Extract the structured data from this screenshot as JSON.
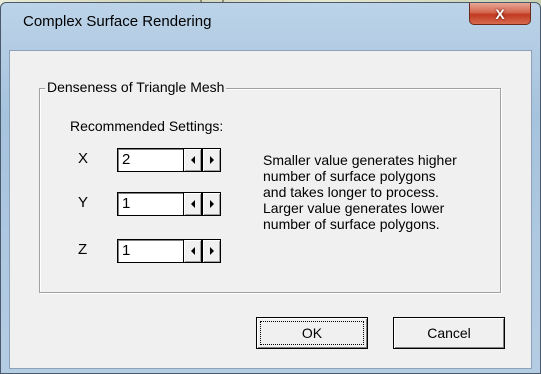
{
  "window": {
    "title": "Complex Surface Rendering",
    "close_label": "X"
  },
  "group": {
    "label": "Denseness of Triangle Mesh",
    "recommended_label": "Recommended Settings:"
  },
  "fields": [
    {
      "axis": "X",
      "value": "2"
    },
    {
      "axis": "Y",
      "value": "1"
    },
    {
      "axis": "Z",
      "value": "1"
    }
  ],
  "help_lines": [
    "Smaller value generates higher",
    "number of surface polygons",
    "and takes longer to process.",
    "Larger value generates lower",
    "number of surface polygons."
  ],
  "buttons": {
    "ok": "OK",
    "cancel": "Cancel"
  }
}
